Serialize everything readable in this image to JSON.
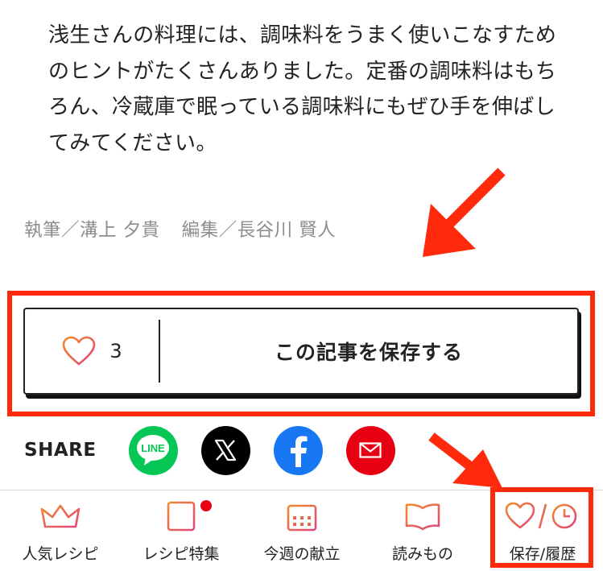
{
  "article": {
    "body": "浅生さんの料理には、調味料をうまく使いこなすためのヒントがたくさんありました。定番の調味料はもちろん、冷蔵庫で眠っている調味料にもぜひ手を伸ばしてみてください。"
  },
  "credit": {
    "writer": "執筆／溝上 夕貴",
    "editor": "編集／長谷川 賢人"
  },
  "save_card": {
    "like_count": "3",
    "save_label": "この記事を保存する"
  },
  "share": {
    "label": "SHARE",
    "line_label": "LINE"
  },
  "bottom_nav": {
    "items": [
      {
        "label": "人気レシピ",
        "icon": "crown-icon"
      },
      {
        "label": "レシピ特集",
        "icon": "list-icon"
      },
      {
        "label": "今週の献立",
        "icon": "calendar-icon"
      },
      {
        "label": "読みもの",
        "icon": "book-icon"
      },
      {
        "label": "保存/履歴",
        "icon": "heart-clock-icon"
      }
    ]
  },
  "colors": {
    "annotation_red": "#ff2a0c",
    "accent_gradient_start": "#f08a2c",
    "accent_gradient_end": "#e2457c",
    "line_green": "#06c755",
    "facebook_blue": "#1877f2",
    "mail_red": "#e60012",
    "credit_gray": "#8d8d8d"
  }
}
